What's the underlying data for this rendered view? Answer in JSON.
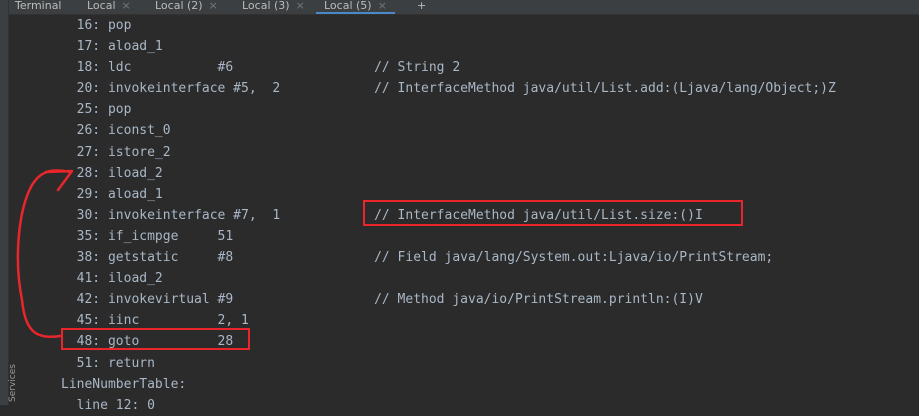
{
  "tabs": [
    {
      "label": "Terminal"
    },
    {
      "label": "Local"
    },
    {
      "label": "Local (2)"
    },
    {
      "label": "Local (3)"
    },
    {
      "label": "Local (5)"
    }
  ],
  "add_tab": "+",
  "side_label": "Services",
  "lines": [
    "  16: pop",
    "  17: aload_1",
    "  18: ldc           #6                  // String 2",
    "  20: invokeinterface #5,  2            // InterfaceMethod java/util/List.add:(Ljava/lang/Object;)Z",
    "  25: pop",
    "  26: iconst_0",
    "  27: istore_2",
    "  28: iload_2",
    "  29: aload_1",
    "  30: invokeinterface #7,  1            // InterfaceMethod java/util/List.size:()I",
    "  35: if_icmpge     51",
    "  38: getstatic     #8                  // Field java/lang/System.out:Ljava/io/PrintStream;",
    "  41: iload_2",
    "  42: invokevirtual #9                  // Method java/io/PrintStream.println:(I)V",
    "  45: iinc          2, 1",
    "  48: goto          28",
    "  51: return",
    "LineNumberTable:",
    "  line 12: 0"
  ],
  "colors": {
    "annotation": "#e8262b",
    "background": "#2b2b2b",
    "text": "#a9b7c6",
    "tab_accent": "#4a88c7"
  }
}
